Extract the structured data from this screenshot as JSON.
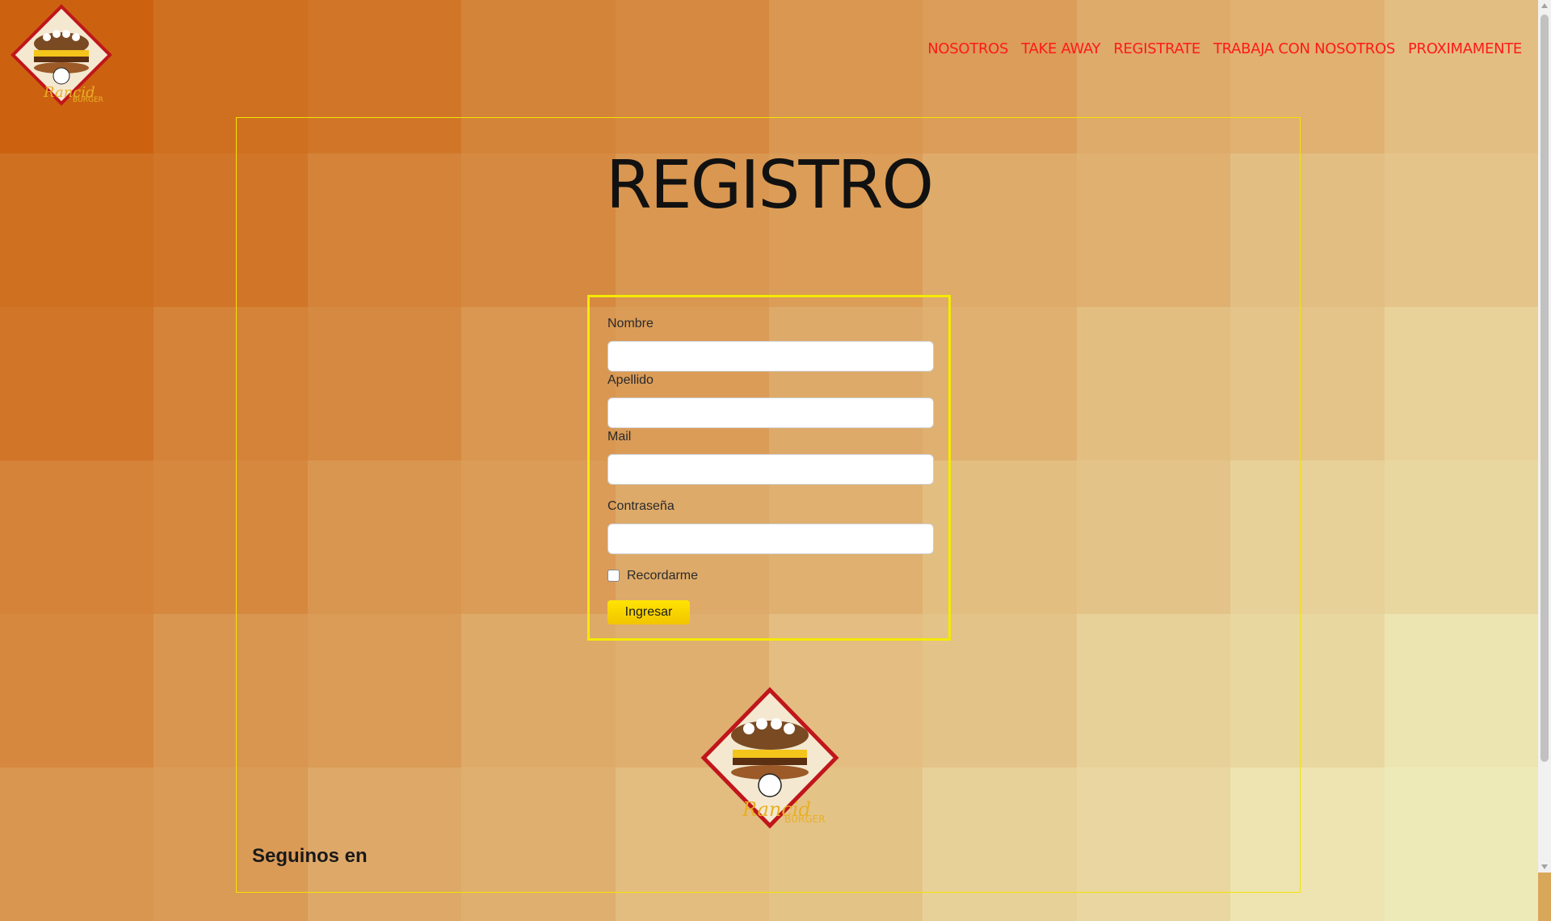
{
  "brand": {
    "logo_text": "Rancid Burger"
  },
  "nav": {
    "items": [
      "NOSOTROS",
      "TAKE AWAY",
      "REGISTRATE",
      "TRABAJA CON NOSOTROS",
      "PROXIMAMENTE"
    ],
    "color": "#ff1a1a"
  },
  "page": {
    "title": "REGISTRO"
  },
  "form": {
    "nombre_label": "Nombre",
    "nombre_value": "",
    "apellido_label": "Apellido",
    "apellido_value": "",
    "mail_label": "Mail",
    "mail_value": "",
    "password_label": "Contraseña",
    "password_value": "",
    "remember_label": "Recordarme",
    "remember_checked": false,
    "submit_label": "Ingresar"
  },
  "footer": {
    "follow_label": "Seguinos en"
  },
  "colors": {
    "accent_yellow": "#f5ea00",
    "nav_red": "#ff1a1a"
  }
}
